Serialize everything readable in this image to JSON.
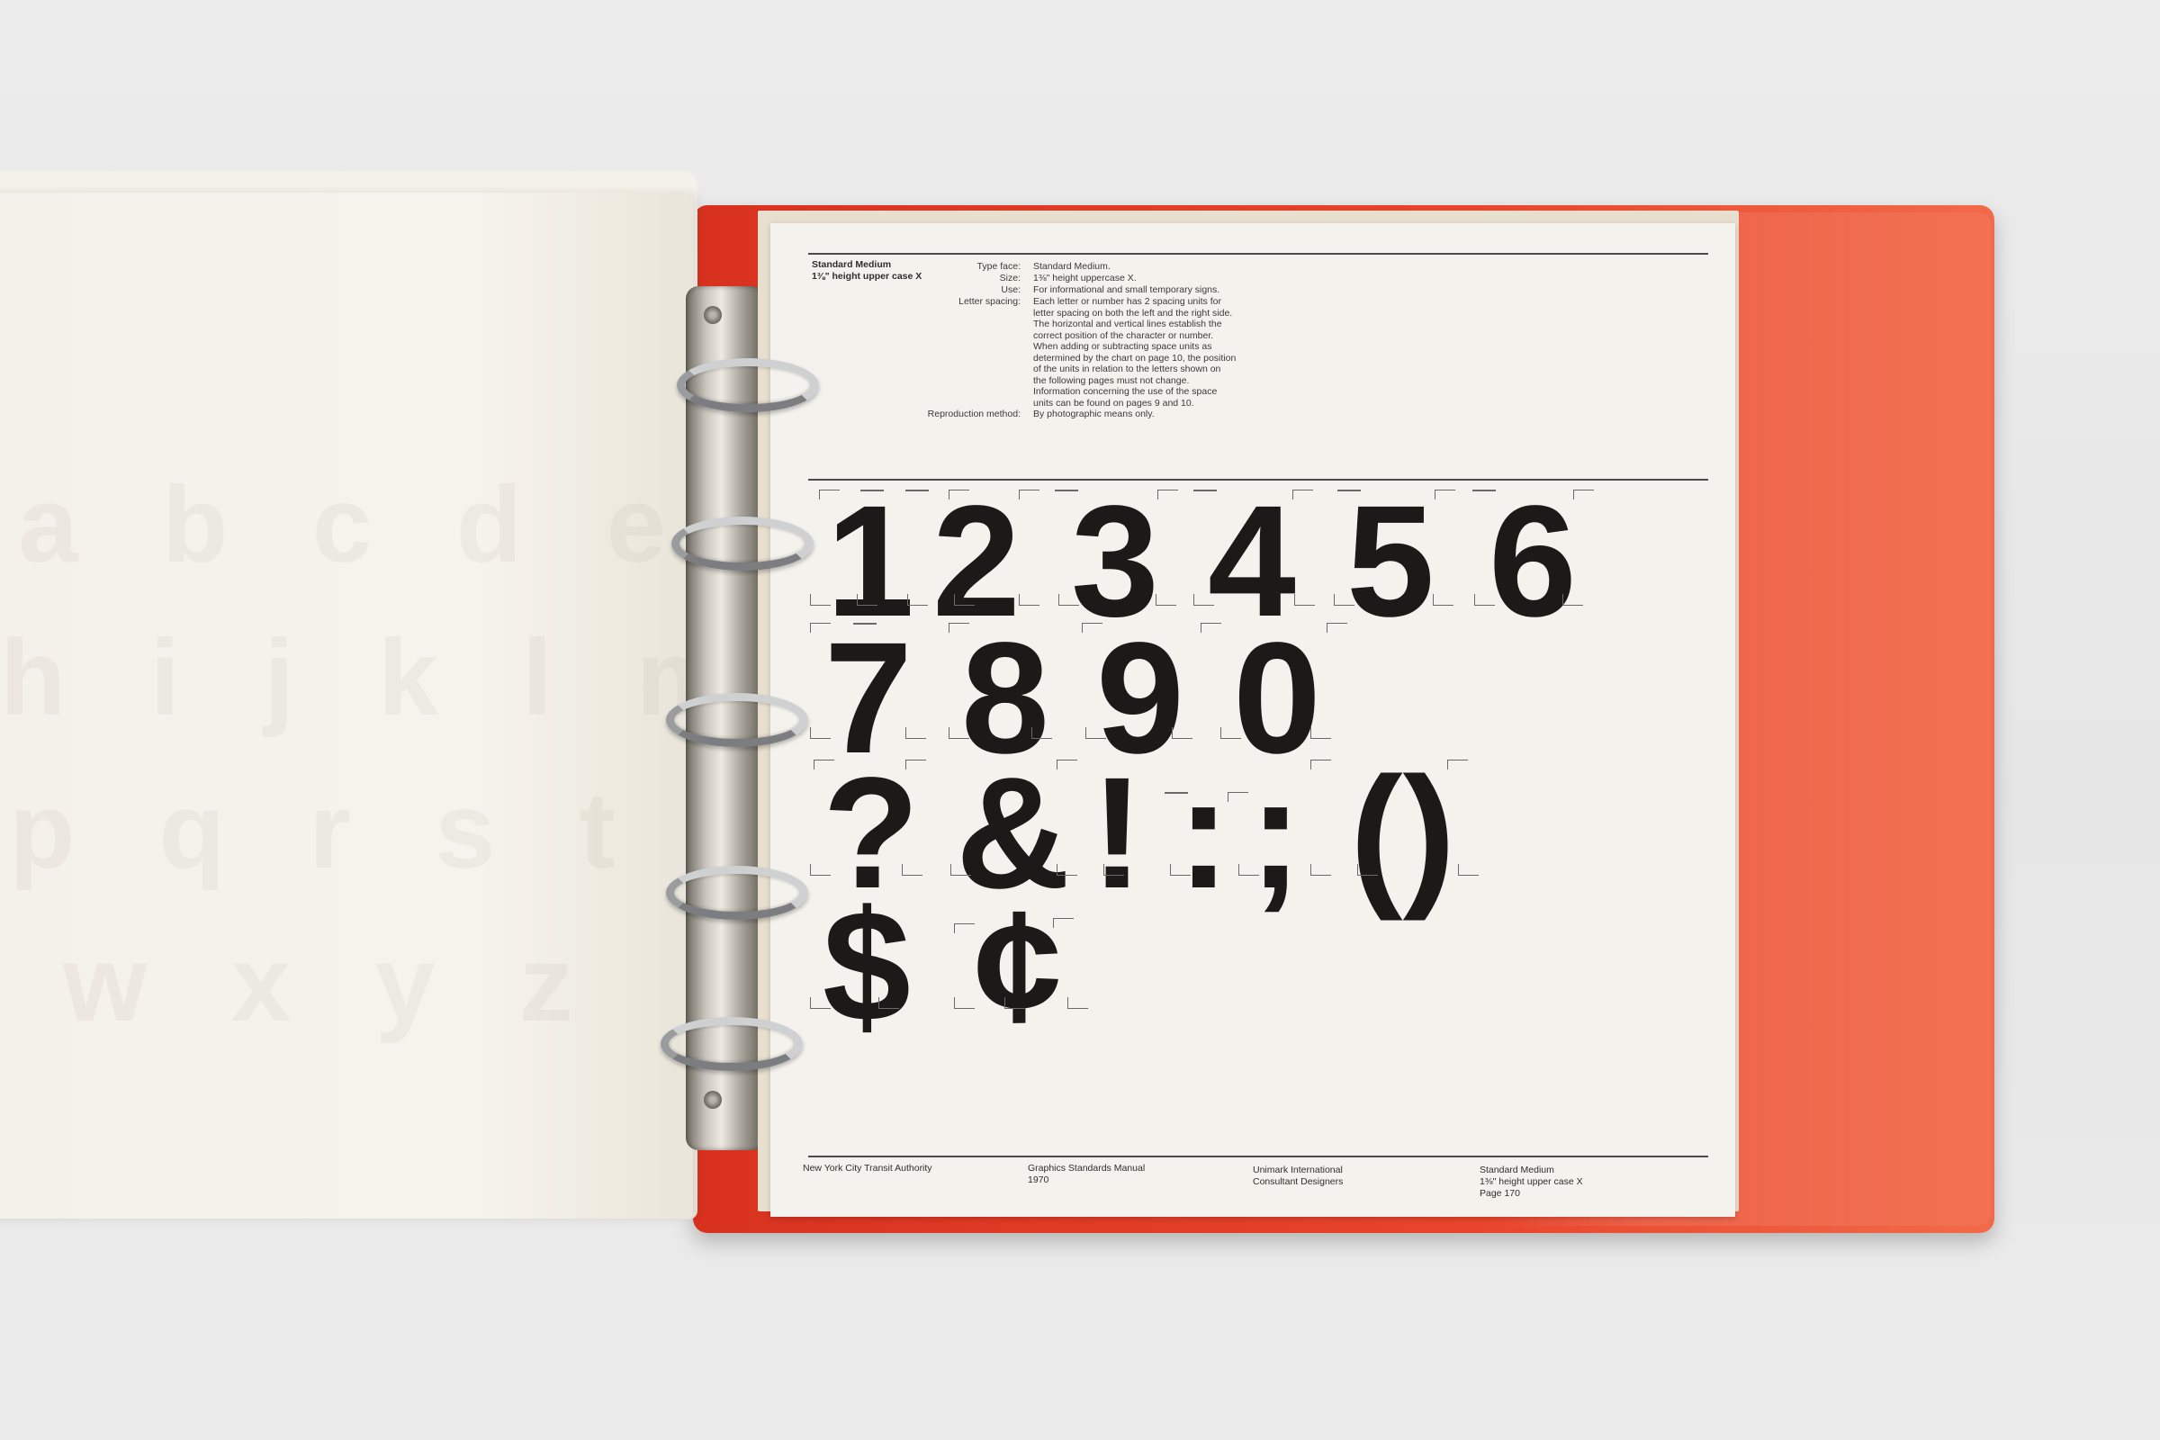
{
  "left_page_ghost": {
    "row1": "a b c d e",
    "row2": "h i j k l m",
    "row3": "p q r s t u",
    "row4": "w x y z"
  },
  "page": {
    "header_title": "Standard Medium",
    "header_subtitle": "1⅜\" height upper case X",
    "spec_labels": {
      "type_face": "Type face:",
      "size": "Size:",
      "use": "Use:",
      "letter_spacing": "Letter spacing:",
      "reproduction": "Reproduction method:"
    },
    "spec_values": {
      "type_face": "Standard Medium.",
      "size": "1⅜\" height uppercase X.",
      "use": "For informational and small temporary signs.",
      "letter_spacing": [
        "Each letter or number has 2 spacing units for",
        "letter spacing on both the left and the right side.",
        "The horizontal and vertical lines establish the",
        "correct position of the character or number.",
        "When adding or subtracting space units as",
        "determined by the chart on page 10, the position",
        "of the units in relation to the letters shown on",
        "the following pages must not change.",
        "Information concerning the use of the space",
        "units can be found on pages 9 and 10."
      ],
      "reproduction": "By photographic means only."
    },
    "glyph_rows": [
      [
        "1",
        "2",
        "3",
        "4",
        "5",
        "6"
      ],
      [
        "7",
        "8",
        "9",
        "0"
      ],
      [
        "?",
        "&",
        "!",
        ":",
        ";",
        "()"
      ],
      [
        "$",
        "¢"
      ]
    ],
    "footer": {
      "col1": "New York City Transit Authority",
      "col2_line1": "Graphics Standards Manual",
      "col2_line2": "1970",
      "col3_line1": "Unimark International",
      "col3_line2": "Consultant Designers",
      "col4_line1": "Standard Medium",
      "col4_line2": "1⅜\" height upper case X",
      "col4_line3": "Page 170"
    }
  },
  "colors": {
    "binder_red": "#e8452c",
    "page_paper": "#f4f2ec",
    "ink": "#1c1a19"
  }
}
